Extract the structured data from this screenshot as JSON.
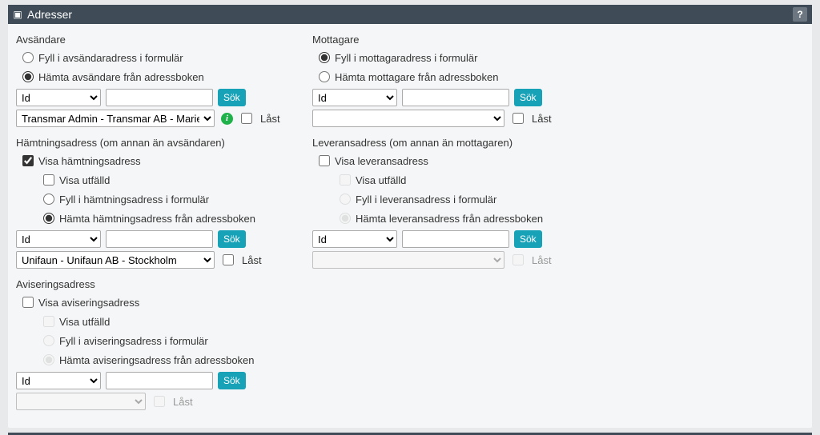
{
  "panel": {
    "title": "Adresser",
    "help_label": "?"
  },
  "common": {
    "search_btn": "Sök",
    "locked_label": "Låst",
    "id_option": "Id"
  },
  "sender": {
    "title": "Avsändare",
    "radio_fill": "Fyll i avsändaradress i formulär",
    "radio_fetch": "Hämta avsändare från adressboken",
    "result": "Transmar Admin - Transmar AB - Marieha"
  },
  "receiver": {
    "title": "Mottagare",
    "radio_fill": "Fyll i mottagaradress i formulär",
    "radio_fetch": "Hämta mottagare från adressboken"
  },
  "pickup": {
    "title": "Hämtningsadress (om annan än avsändaren)",
    "chk_show": "Visa hämtningsadress",
    "chk_expanded": "Visa utfälld",
    "radio_fill": "Fyll i hämtningsadress i formulär",
    "radio_fetch": "Hämta hämtningsadress från adressboken",
    "result": "Unifaun - Unifaun AB - Stockholm"
  },
  "delivery": {
    "title": "Leveransadress (om annan än mottagaren)",
    "chk_show": "Visa leveransadress",
    "chk_expanded": "Visa utfälld",
    "radio_fill": "Fyll i leveransadress i formulär",
    "radio_fetch": "Hämta leveransadress från adressboken"
  },
  "notify": {
    "title": "Aviseringsadress",
    "chk_show": "Visa aviseringsadress",
    "chk_expanded": "Visa utfälld",
    "radio_fill": "Fyll i aviseringsadress i formulär",
    "radio_fetch": "Hämta aviseringsadress från adressboken"
  }
}
